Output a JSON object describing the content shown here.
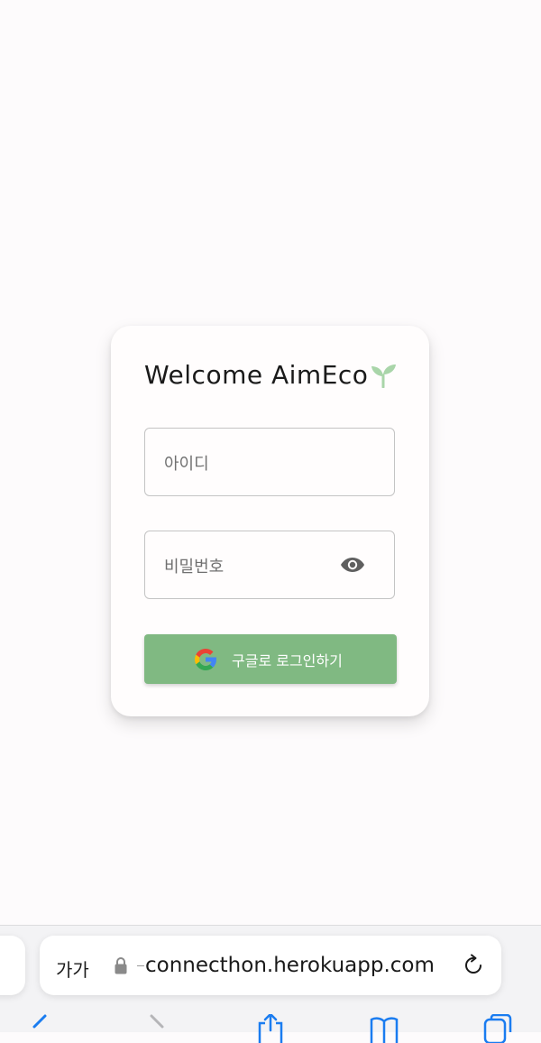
{
  "login": {
    "title": "Welcome AimEco",
    "title_icon": "sprout-icon",
    "id_placeholder": "아이디",
    "password_placeholder": "비밀번호",
    "password_toggle_icon": "eye-icon",
    "google_button_label": "구글로 로그인하기",
    "google_icon": "google-icon"
  },
  "colors": {
    "background": "#fdfbfc",
    "card": "#fffdfd",
    "google_button": "#80b982",
    "sprout": "#a9d5a9"
  },
  "browser": {
    "text_size_label": "가가",
    "url": "connecthon.herokuapp.com",
    "lock_icon": "lock-icon",
    "reload_icon": "reload-icon",
    "toolbar_icons": [
      "back-icon",
      "forward-icon",
      "share-icon",
      "bookmarks-icon",
      "tabs-icon"
    ]
  }
}
